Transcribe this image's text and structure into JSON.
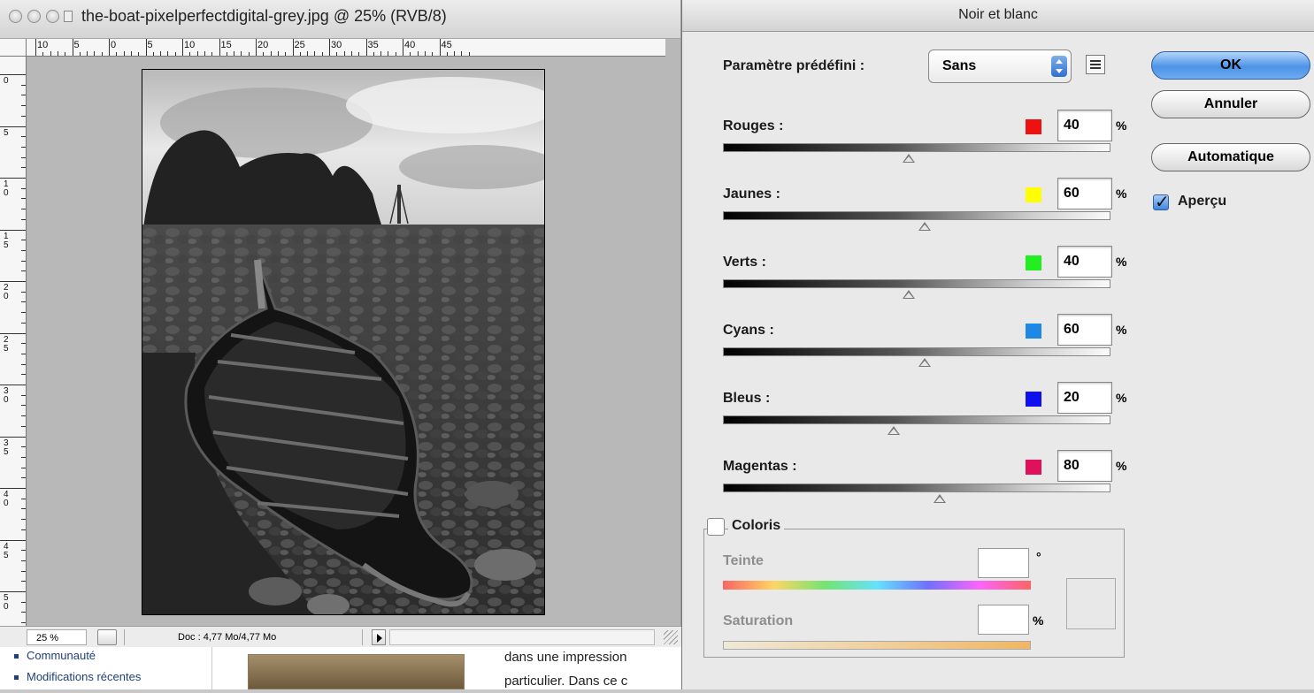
{
  "document": {
    "title": "the-boat-pixelperfectdigital-grey.jpg @ 25% (RVB/8)",
    "ruler_h_labels": [
      "10",
      "5",
      "0",
      "5",
      "10",
      "15",
      "20",
      "25",
      "30",
      "35",
      "40",
      "45"
    ],
    "ruler_v_labels": [
      "0",
      "5",
      "10",
      "15",
      "20",
      "25",
      "30",
      "35",
      "40",
      "45",
      "50"
    ],
    "status": {
      "zoom": "25 %",
      "doc_info": "Doc : 4,77 Mo/4,77 Mo"
    }
  },
  "background_page": {
    "nav_items": [
      "Communauté",
      "Modifications récentes"
    ],
    "paragraph_lines": [
      "dans une impression",
      "particulier. Dans ce c"
    ]
  },
  "dialog": {
    "title": "Noir et blanc",
    "preset": {
      "label": "Paramètre prédéfini :",
      "value": "Sans"
    },
    "percent_sign": "%",
    "channels": [
      {
        "label": "Rouges :",
        "value": "40",
        "color": "#ee1111"
      },
      {
        "label": "Jaunes :",
        "value": "60",
        "color": "#ffff00"
      },
      {
        "label": "Verts :",
        "value": "40",
        "color": "#22ee22"
      },
      {
        "label": "Cyans :",
        "value": "60",
        "color": "#1e88e5"
      },
      {
        "label": "Bleus :",
        "value": "20",
        "color": "#1010ee"
      },
      {
        "label": "Magentas :",
        "value": "80",
        "color": "#e0105a"
      }
    ],
    "buttons": {
      "ok": "OK",
      "cancel": "Annuler",
      "auto": "Automatique"
    },
    "preview": {
      "label": "Aperçu",
      "checked": true
    },
    "tint": {
      "label": "Coloris",
      "checked": false,
      "hue_label": "Teinte",
      "hue_unit": "°",
      "saturation_label": "Saturation",
      "saturation_unit": "%"
    }
  }
}
